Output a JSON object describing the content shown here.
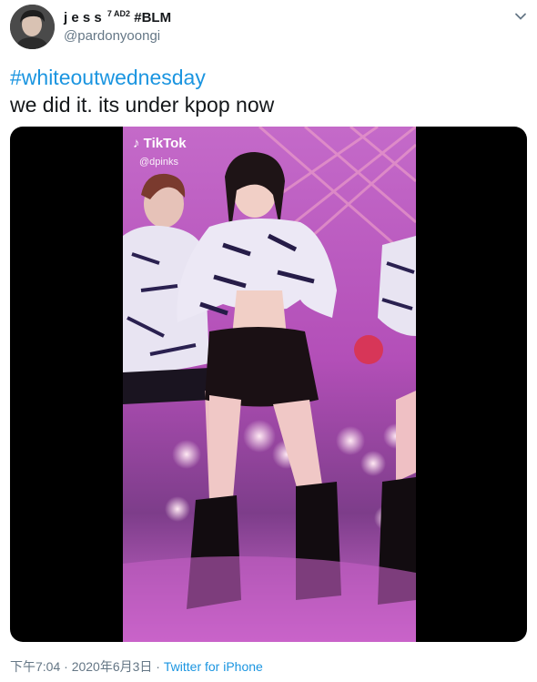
{
  "tweet": {
    "author": {
      "display_name": "j e s s",
      "name_superscript": "7 AD2",
      "name_suffix": "#BLM",
      "handle": "@pardonyoongi",
      "avatar_icon": "user-avatar-photo"
    },
    "hashtag": "#whiteoutwednesday",
    "text": "we did it. its under kpop now",
    "media": {
      "type": "video",
      "watermark_app": "TikTok",
      "watermark_user": "@dpinks"
    },
    "meta": {
      "time": "下午7:04",
      "separator": " · ",
      "date": "2020年6月3日",
      "separator2": " · ",
      "source": "Twitter for iPhone"
    },
    "menu_icon": "chevron-down-icon"
  },
  "colors": {
    "link": "#1b95e0",
    "secondary_text": "#657786",
    "primary_text": "#14171a"
  }
}
